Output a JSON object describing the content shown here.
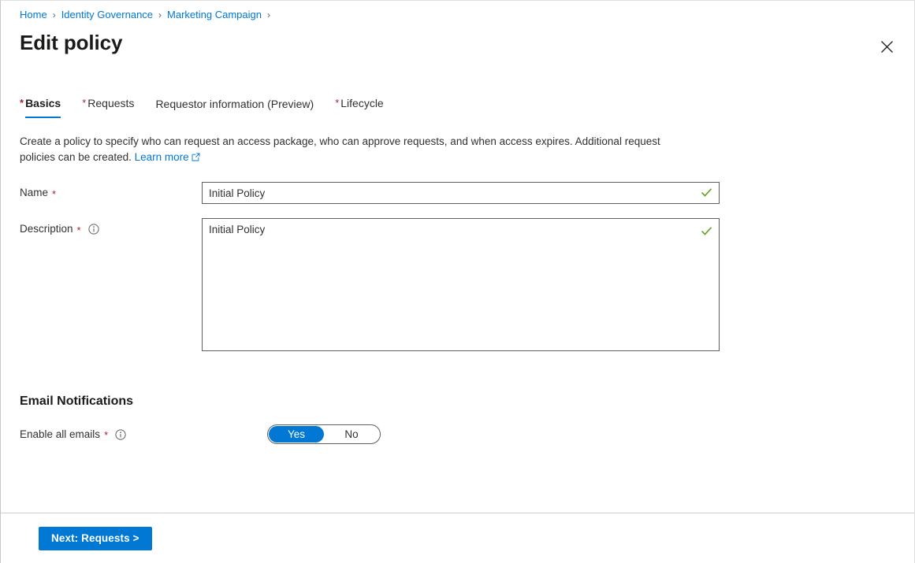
{
  "breadcrumb": {
    "separator": "›",
    "items": [
      {
        "label": "Home"
      },
      {
        "label": "Identity Governance"
      },
      {
        "label": "Marketing Campaign"
      }
    ]
  },
  "header": {
    "title": "Edit policy",
    "close_label": "Close",
    "close_icon": "close-icon"
  },
  "tabs": [
    {
      "label": "Basics",
      "required": "*",
      "active": true
    },
    {
      "label": "Requests",
      "required": "*",
      "active": false
    },
    {
      "label": "Requestor information (Preview)",
      "required": "",
      "active": false
    },
    {
      "label": "Lifecycle",
      "required": "*",
      "active": false
    }
  ],
  "intro": {
    "text": "Create a policy to specify who can request an access package, who can approve requests, and when access expires. Additional request policies can be created.",
    "link_label": "Learn more",
    "link_icon": "external-link-icon"
  },
  "form": {
    "name": {
      "label": "Name",
      "required": "*",
      "value": "Initial Policy",
      "placeholder": "",
      "valid_icon": "checkmark-icon"
    },
    "description": {
      "label": "Description",
      "required": "*",
      "info_icon": "info-icon",
      "value": "Initial Policy",
      "placeholder": "",
      "valid_icon": "checkmark-icon"
    }
  },
  "email_notifications": {
    "heading": "Email Notifications",
    "toggle": {
      "label": "Enable all emails",
      "required": "*",
      "info_icon": "info-icon",
      "options": [
        {
          "label": "Yes",
          "selected": true
        },
        {
          "label": "No",
          "selected": false
        }
      ],
      "value": "Yes"
    }
  },
  "footer": {
    "next_button": "Next: Requests >"
  },
  "colors": {
    "accent": "#0078d4",
    "link": "#0078d4",
    "required_star": "#a4262c",
    "valid_green": "#5ca422",
    "text": "#323130",
    "border": "#605e5c"
  }
}
